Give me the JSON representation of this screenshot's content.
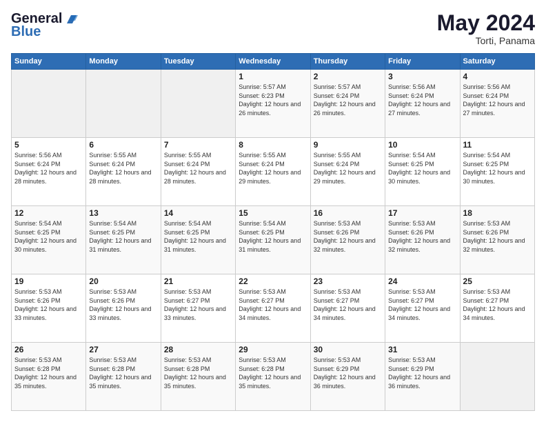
{
  "header": {
    "logo_general": "General",
    "logo_blue": "Blue",
    "month_title": "May 2024",
    "location": "Torti, Panama"
  },
  "weekdays": [
    "Sunday",
    "Monday",
    "Tuesday",
    "Wednesday",
    "Thursday",
    "Friday",
    "Saturday"
  ],
  "weeks": [
    [
      {
        "day": "",
        "sunrise": "",
        "sunset": "",
        "daylight": ""
      },
      {
        "day": "",
        "sunrise": "",
        "sunset": "",
        "daylight": ""
      },
      {
        "day": "",
        "sunrise": "",
        "sunset": "",
        "daylight": ""
      },
      {
        "day": "1",
        "sunrise": "Sunrise: 5:57 AM",
        "sunset": "Sunset: 6:23 PM",
        "daylight": "Daylight: 12 hours and 26 minutes."
      },
      {
        "day": "2",
        "sunrise": "Sunrise: 5:57 AM",
        "sunset": "Sunset: 6:24 PM",
        "daylight": "Daylight: 12 hours and 26 minutes."
      },
      {
        "day": "3",
        "sunrise": "Sunrise: 5:56 AM",
        "sunset": "Sunset: 6:24 PM",
        "daylight": "Daylight: 12 hours and 27 minutes."
      },
      {
        "day": "4",
        "sunrise": "Sunrise: 5:56 AM",
        "sunset": "Sunset: 6:24 PM",
        "daylight": "Daylight: 12 hours and 27 minutes."
      }
    ],
    [
      {
        "day": "5",
        "sunrise": "Sunrise: 5:56 AM",
        "sunset": "Sunset: 6:24 PM",
        "daylight": "Daylight: 12 hours and 28 minutes."
      },
      {
        "day": "6",
        "sunrise": "Sunrise: 5:55 AM",
        "sunset": "Sunset: 6:24 PM",
        "daylight": "Daylight: 12 hours and 28 minutes."
      },
      {
        "day": "7",
        "sunrise": "Sunrise: 5:55 AM",
        "sunset": "Sunset: 6:24 PM",
        "daylight": "Daylight: 12 hours and 28 minutes."
      },
      {
        "day": "8",
        "sunrise": "Sunrise: 5:55 AM",
        "sunset": "Sunset: 6:24 PM",
        "daylight": "Daylight: 12 hours and 29 minutes."
      },
      {
        "day": "9",
        "sunrise": "Sunrise: 5:55 AM",
        "sunset": "Sunset: 6:24 PM",
        "daylight": "Daylight: 12 hours and 29 minutes."
      },
      {
        "day": "10",
        "sunrise": "Sunrise: 5:54 AM",
        "sunset": "Sunset: 6:25 PM",
        "daylight": "Daylight: 12 hours and 30 minutes."
      },
      {
        "day": "11",
        "sunrise": "Sunrise: 5:54 AM",
        "sunset": "Sunset: 6:25 PM",
        "daylight": "Daylight: 12 hours and 30 minutes."
      }
    ],
    [
      {
        "day": "12",
        "sunrise": "Sunrise: 5:54 AM",
        "sunset": "Sunset: 6:25 PM",
        "daylight": "Daylight: 12 hours and 30 minutes."
      },
      {
        "day": "13",
        "sunrise": "Sunrise: 5:54 AM",
        "sunset": "Sunset: 6:25 PM",
        "daylight": "Daylight: 12 hours and 31 minutes."
      },
      {
        "day": "14",
        "sunrise": "Sunrise: 5:54 AM",
        "sunset": "Sunset: 6:25 PM",
        "daylight": "Daylight: 12 hours and 31 minutes."
      },
      {
        "day": "15",
        "sunrise": "Sunrise: 5:54 AM",
        "sunset": "Sunset: 6:25 PM",
        "daylight": "Daylight: 12 hours and 31 minutes."
      },
      {
        "day": "16",
        "sunrise": "Sunrise: 5:53 AM",
        "sunset": "Sunset: 6:26 PM",
        "daylight": "Daylight: 12 hours and 32 minutes."
      },
      {
        "day": "17",
        "sunrise": "Sunrise: 5:53 AM",
        "sunset": "Sunset: 6:26 PM",
        "daylight": "Daylight: 12 hours and 32 minutes."
      },
      {
        "day": "18",
        "sunrise": "Sunrise: 5:53 AM",
        "sunset": "Sunset: 6:26 PM",
        "daylight": "Daylight: 12 hours and 32 minutes."
      }
    ],
    [
      {
        "day": "19",
        "sunrise": "Sunrise: 5:53 AM",
        "sunset": "Sunset: 6:26 PM",
        "daylight": "Daylight: 12 hours and 33 minutes."
      },
      {
        "day": "20",
        "sunrise": "Sunrise: 5:53 AM",
        "sunset": "Sunset: 6:26 PM",
        "daylight": "Daylight: 12 hours and 33 minutes."
      },
      {
        "day": "21",
        "sunrise": "Sunrise: 5:53 AM",
        "sunset": "Sunset: 6:27 PM",
        "daylight": "Daylight: 12 hours and 33 minutes."
      },
      {
        "day": "22",
        "sunrise": "Sunrise: 5:53 AM",
        "sunset": "Sunset: 6:27 PM",
        "daylight": "Daylight: 12 hours and 34 minutes."
      },
      {
        "day": "23",
        "sunrise": "Sunrise: 5:53 AM",
        "sunset": "Sunset: 6:27 PM",
        "daylight": "Daylight: 12 hours and 34 minutes."
      },
      {
        "day": "24",
        "sunrise": "Sunrise: 5:53 AM",
        "sunset": "Sunset: 6:27 PM",
        "daylight": "Daylight: 12 hours and 34 minutes."
      },
      {
        "day": "25",
        "sunrise": "Sunrise: 5:53 AM",
        "sunset": "Sunset: 6:27 PM",
        "daylight": "Daylight: 12 hours and 34 minutes."
      }
    ],
    [
      {
        "day": "26",
        "sunrise": "Sunrise: 5:53 AM",
        "sunset": "Sunset: 6:28 PM",
        "daylight": "Daylight: 12 hours and 35 minutes."
      },
      {
        "day": "27",
        "sunrise": "Sunrise: 5:53 AM",
        "sunset": "Sunset: 6:28 PM",
        "daylight": "Daylight: 12 hours and 35 minutes."
      },
      {
        "day": "28",
        "sunrise": "Sunrise: 5:53 AM",
        "sunset": "Sunset: 6:28 PM",
        "daylight": "Daylight: 12 hours and 35 minutes."
      },
      {
        "day": "29",
        "sunrise": "Sunrise: 5:53 AM",
        "sunset": "Sunset: 6:28 PM",
        "daylight": "Daylight: 12 hours and 35 minutes."
      },
      {
        "day": "30",
        "sunrise": "Sunrise: 5:53 AM",
        "sunset": "Sunset: 6:29 PM",
        "daylight": "Daylight: 12 hours and 36 minutes."
      },
      {
        "day": "31",
        "sunrise": "Sunrise: 5:53 AM",
        "sunset": "Sunset: 6:29 PM",
        "daylight": "Daylight: 12 hours and 36 minutes."
      },
      {
        "day": "",
        "sunrise": "",
        "sunset": "",
        "daylight": ""
      }
    ]
  ]
}
